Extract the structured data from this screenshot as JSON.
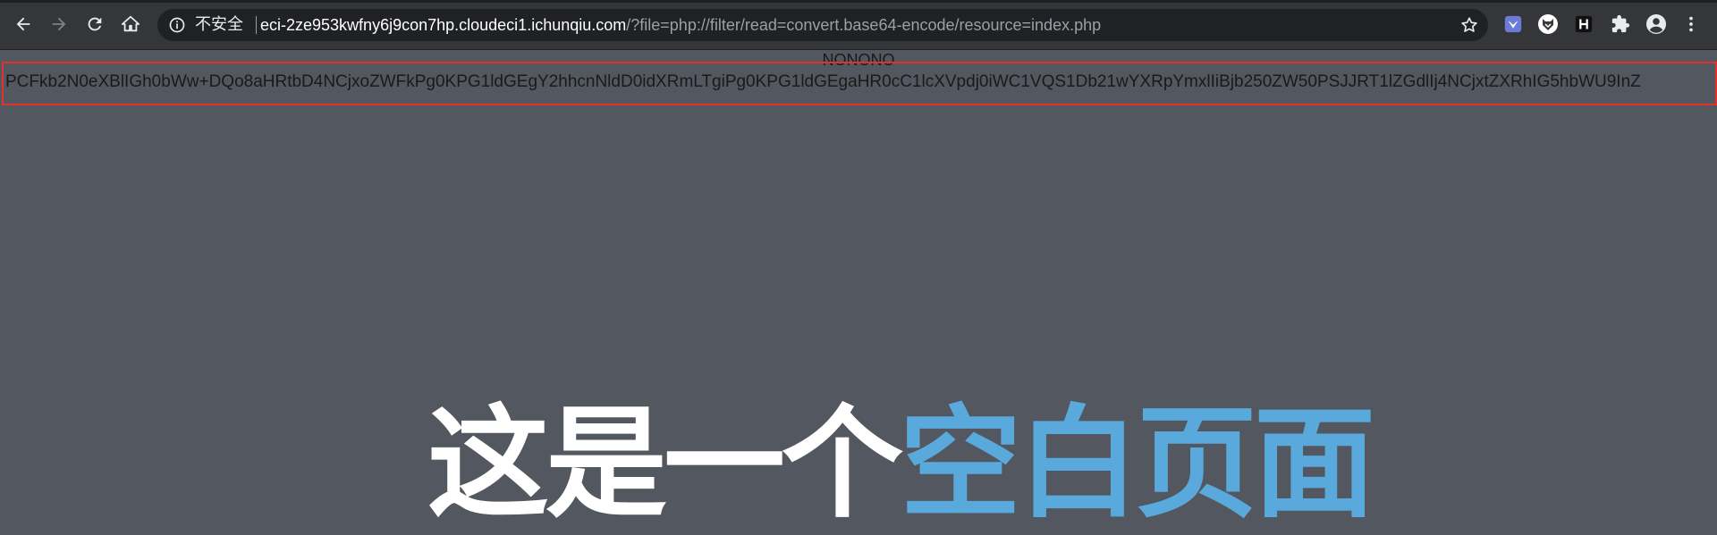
{
  "browser": {
    "security_label": "不安全",
    "url_host": "eci-2ze953kwfny6j9con7hp.cloudeci1.ichunqiu.com",
    "url_path": "/?file=php://filter/read=convert.base64-encode/resource=index.php"
  },
  "page": {
    "message": "NONONO",
    "base64_output": "PCFkb2N0eXBlIGh0bWw+DQo8aHRtbD4NCjxoZWFkPg0KPG1ldGEgY2hhcnNldD0idXRmLTgiPg0KPG1ldGEgaHR0cC1lcXVpdj0iWC1VQS1Db21wYXRpYmxlIiBjb250ZW50PSJJRT1lZGdlIj4NCjxtZXRhIG5hbWU9InZ",
    "headline_white": "这是一个",
    "headline_blue": "空白页面"
  },
  "colors": {
    "page_background": "#53575f",
    "highlight_border": "#e0312b",
    "headline_blue": "#5aa9dd"
  }
}
